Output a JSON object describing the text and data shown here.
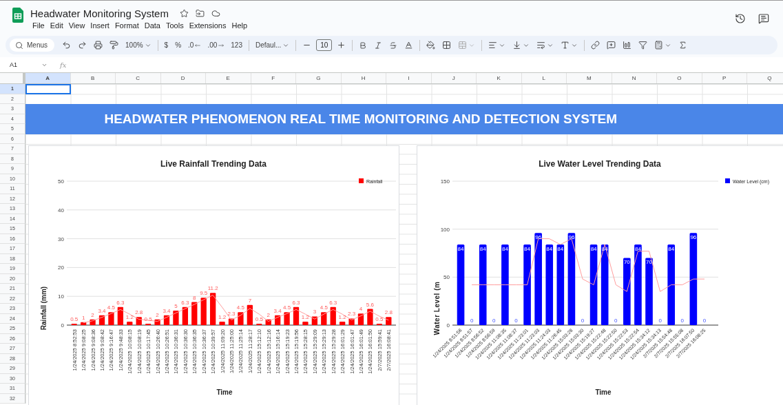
{
  "app": {
    "title": "Headwater Monitoring System"
  },
  "menu": [
    "File",
    "Edit",
    "View",
    "Insert",
    "Format",
    "Data",
    "Tools",
    "Extensions",
    "Help"
  ],
  "toolbar": {
    "search": "Menus",
    "zoom": "100%",
    "currency": "$",
    "percent": "%",
    "decrease_decimal": ".0",
    "increase_decimal": ".00",
    "number_format": "123",
    "font": "Defaul...",
    "font_size": "10"
  },
  "name_box": "A1",
  "formula_label": "fx",
  "columns": [
    {
      "label": "A",
      "selected": true
    },
    {
      "label": "B",
      "selected": false
    },
    {
      "label": "C",
      "selected": false
    },
    {
      "label": "D",
      "selected": false
    },
    {
      "label": "E",
      "selected": false
    },
    {
      "label": "F",
      "selected": false
    },
    {
      "label": "G",
      "selected": false
    },
    {
      "label": "H",
      "selected": false
    },
    {
      "label": "I",
      "selected": false
    },
    {
      "label": "J",
      "selected": false
    },
    {
      "label": "K",
      "selected": false
    },
    {
      "label": "L",
      "selected": false
    },
    {
      "label": "M",
      "selected": false
    },
    {
      "label": "N",
      "selected": false
    },
    {
      "label": "O",
      "selected": false
    },
    {
      "label": "P",
      "selected": false
    },
    {
      "label": "Q",
      "selected": false
    }
  ],
  "rows": [
    {
      "label": "1",
      "selected": true
    },
    {
      "label": "2",
      "selected": false
    },
    {
      "label": "3",
      "selected": false
    },
    {
      "label": "4",
      "selected": false
    },
    {
      "label": "5",
      "selected": false
    },
    {
      "label": "6",
      "selected": false
    },
    {
      "label": "7",
      "selected": false
    },
    {
      "label": "8",
      "selected": false
    },
    {
      "label": "9",
      "selected": false
    },
    {
      "label": "10",
      "selected": false
    },
    {
      "label": "11",
      "selected": false
    },
    {
      "label": "12",
      "selected": false
    },
    {
      "label": "13",
      "selected": false
    },
    {
      "label": "14",
      "selected": false
    },
    {
      "label": "15",
      "selected": false
    },
    {
      "label": "16",
      "selected": false
    },
    {
      "label": "17",
      "selected": false
    },
    {
      "label": "18",
      "selected": false
    },
    {
      "label": "19",
      "selected": false
    },
    {
      "label": "20",
      "selected": false
    },
    {
      "label": "21",
      "selected": false
    },
    {
      "label": "22",
      "selected": false
    },
    {
      "label": "23",
      "selected": false
    },
    {
      "label": "24",
      "selected": false
    },
    {
      "label": "25",
      "selected": false
    },
    {
      "label": "26",
      "selected": false
    },
    {
      "label": "27",
      "selected": false
    },
    {
      "label": "28",
      "selected": false
    },
    {
      "label": "29",
      "selected": false
    },
    {
      "label": "30",
      "selected": false
    },
    {
      "label": "31",
      "selected": false
    },
    {
      "label": "32",
      "selected": false
    }
  ],
  "banner": "HEADWATER PHENOMENON REAL TIME MONITORING AND DETECTION SYSTEM",
  "charts": [
    {
      "chart_data": {
        "type": "bar",
        "title": "Live Rainfall Trending Data",
        "xlabel": "Time",
        "ylabel": "Rainfall (mm)",
        "categories": [
          "1/24/2025 8:52:53",
          "1/24/2025 9:08:25",
          "1/24/2025 9:08:36",
          "1/24/2025 9:08:42",
          "1/24/2025 9:16:47",
          "1/24/2025 9:48:33",
          "1/24/2025 10:08:15",
          "1/24/2025 10:08:19",
          "1/24/2025 10:17:45",
          "1/24/2025 10:26:40",
          "1/24/2025 10:26:51",
          "1/24/2025 10:36:31",
          "1/24/2025 10:36:30",
          "1/24/2025 10:36:35",
          "1/24/2025 10:36:37",
          "1/24/2025 10:39:57",
          "1/24/2025 11:09:20",
          "1/24/2025 11:25:00",
          "1/24/2025 11:25:14",
          "1/24/2025 11:28:17",
          "1/24/2025 15:12:10",
          "1/24/2025 15:12:16",
          "1/24/2025 15:16:14",
          "1/24/2025 15:19:23",
          "1/24/2025 15:19:56",
          "1/24/2025 15:28:15",
          "1/24/2025 15:29:09",
          "1/24/2025 15:29:13",
          "1/24/2025 15:29:28",
          "1/24/2025 16:01:29",
          "1/24/2025 16:01:47",
          "1/24/2025 16:01:49",
          "1/24/2025 16:01:50",
          "2/7/2025 15:59:41",
          "2/7/2025 16:08:41"
        ],
        "series": [
          {
            "name": "Rainfall",
            "color": "#ff0000",
            "values": [
              0.5,
              1,
              2,
              3.4,
              4.5,
              6.3,
              1.2,
              2.8,
              0.5,
              2,
              3.4,
              5,
              6.3,
              8,
              9.5,
              11.2,
              1.2,
              2.3,
              4.5,
              7,
              0.5,
              2,
              3.4,
              4.5,
              6.3,
              1.2,
              3,
              4.5,
              6.3,
              1.2,
              2.3,
              4,
              5.6,
              0.5,
              2.8
            ],
            "value_labels": [
              "0.5",
              "1",
              "2",
              "3.4",
              "4.5",
              "6.3",
              "1.2",
              "2.8",
              "0.5",
              "2",
              "3.4",
              "5",
              "6.3",
              "8",
              "9.5",
              "11.2",
              "1.2",
              "2.3",
              "4.5",
              "7",
              "0.5",
              "2",
              "3.4",
              "4.5",
              "6.3",
              "1.2",
              "3",
              "4.5",
              "6.3",
              "1.2",
              "2.3",
              "4",
              "5.6",
              "0.5",
              "2.8"
            ]
          },
          {
            "type": "line",
            "color": "#ff9e9e",
            "values": [
              null,
              0.8,
              1.5,
              2.7,
              4,
              5.4,
              3.8,
              2,
              1.7,
              1.3,
              2.7,
              4.2,
              5.7,
              7.2,
              8.8,
              10.4,
              6.2,
              1.8,
              3.4,
              5.8,
              3.8,
              1.3,
              2.7,
              4,
              5.4,
              3.8,
              2.1,
              3.8,
              5.4,
              3.8,
              1.8,
              3.2,
              4.8,
              3.1,
              1.7
            ]
          }
        ],
        "ylim": [
          0,
          50
        ],
        "yticks": [
          0,
          10,
          20,
          30,
          40,
          50
        ],
        "grid": true
      }
    },
    {
      "chart_data": {
        "type": "bar",
        "title": "Live Water Level Trending Data",
        "xlabel": "Time",
        "ylabel": "Water Level (m",
        "categories": [
          "1/24/2025 8:51:56",
          "1/24/2025 8:51:57",
          "1/24/2025 8:56:52",
          "1/24/2025 8:56:59",
          "1/24/2025 11:08:35",
          "1/24/2025 11:08:37",
          "1/24/2025 11:23:01",
          "1/24/2025 11:23:03",
          "1/24/2025 11:24:03",
          "1/24/2025 11:26:45",
          "1/24/2025 15:03:28",
          "1/24/2025 15:03:30",
          "1/24/2025 15:19:27",
          "1/24/2025 15:22:48",
          "1/24/2025 15:22:50",
          "1/24/2025 15:22:53",
          "1/24/2025 15:22:54",
          "1/24/2025 15:34:12",
          "1/24/2025 15:34:13",
          "2/7/2025 15:54:48",
          "2/7/2025 15:55:08",
          "2/7/2025 16:07:50",
          "2/7/2025 16:08:25"
        ],
        "series": [
          {
            "name": "Water Level (cm)",
            "color": "#0000ff",
            "values": [
              84,
              0,
              84,
              0,
              84,
              0,
              84,
              96,
              84,
              84,
              96,
              0,
              84,
              84,
              0,
              70,
              84,
              70,
              0,
              84,
              0,
              96,
              0
            ],
            "value_labels": [
              "84",
              "0",
              "84",
              "0",
              "84",
              "0",
              "84",
              "96",
              "84",
              "84",
              "96",
              "0",
              "84",
              "84",
              "0",
              "70",
              "84",
              "70",
              "0",
              "84",
              "0",
              "96",
              "0"
            ]
          },
          {
            "type": "line",
            "color": "#ff9e9e",
            "values": [
              null,
              42,
              42,
              42,
              42,
              42,
              42,
              90,
              90,
              84,
              90,
              48,
              42,
              84,
              42,
              35,
              77,
              77,
              35,
              42,
              42,
              48,
              48
            ]
          }
        ],
        "ylim": [
          0,
          150
        ],
        "yticks": [
          0,
          50,
          100,
          150
        ],
        "grid": true
      }
    }
  ]
}
